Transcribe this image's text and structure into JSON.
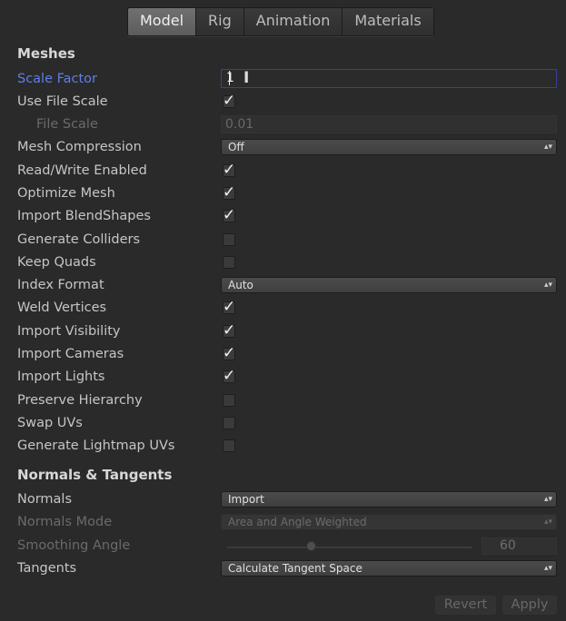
{
  "tabs": [
    "Model",
    "Rig",
    "Animation",
    "Materials"
  ],
  "meshes": {
    "heading": "Meshes",
    "scale_factor": {
      "label": "Scale Factor",
      "value": "1"
    },
    "use_file_scale": {
      "label": "Use File Scale",
      "checked": true
    },
    "file_scale": {
      "label": "File Scale",
      "value": "0.01"
    },
    "mesh_compression": {
      "label": "Mesh Compression",
      "value": "Off"
    },
    "read_write": {
      "label": "Read/Write Enabled",
      "checked": true
    },
    "optimize_mesh": {
      "label": "Optimize Mesh",
      "checked": true
    },
    "import_blendshapes": {
      "label": "Import BlendShapes",
      "checked": true
    },
    "generate_colliders": {
      "label": "Generate Colliders",
      "checked": false
    },
    "keep_quads": {
      "label": "Keep Quads",
      "checked": false
    },
    "index_format": {
      "label": "Index Format",
      "value": "Auto"
    },
    "weld_vertices": {
      "label": "Weld Vertices",
      "checked": true
    },
    "import_visibility": {
      "label": "Import Visibility",
      "checked": true
    },
    "import_cameras": {
      "label": "Import Cameras",
      "checked": true
    },
    "import_lights": {
      "label": "Import Lights",
      "checked": true
    },
    "preserve_hierarchy": {
      "label": "Preserve Hierarchy",
      "checked": false
    },
    "swap_uvs": {
      "label": "Swap UVs",
      "checked": false
    },
    "generate_lightmap_uvs": {
      "label": "Generate Lightmap UVs",
      "checked": false
    }
  },
  "normals_tangents": {
    "heading": "Normals & Tangents",
    "normals": {
      "label": "Normals",
      "value": "Import"
    },
    "normals_mode": {
      "label": "Normals Mode",
      "value": "Area and Angle Weighted"
    },
    "smoothing_angle": {
      "label": "Smoothing Angle",
      "value": "60"
    },
    "tangents": {
      "label": "Tangents",
      "value": "Calculate Tangent Space"
    }
  },
  "buttons": {
    "revert": "Revert",
    "apply": "Apply"
  },
  "colors": {
    "background": "#2a2a2a",
    "focus_label": "#5f7ee8",
    "focus_border": "#3a3f9a"
  },
  "icons": {
    "check": "checkmark-icon",
    "dropdown": "dropdown-arrow-icon"
  }
}
